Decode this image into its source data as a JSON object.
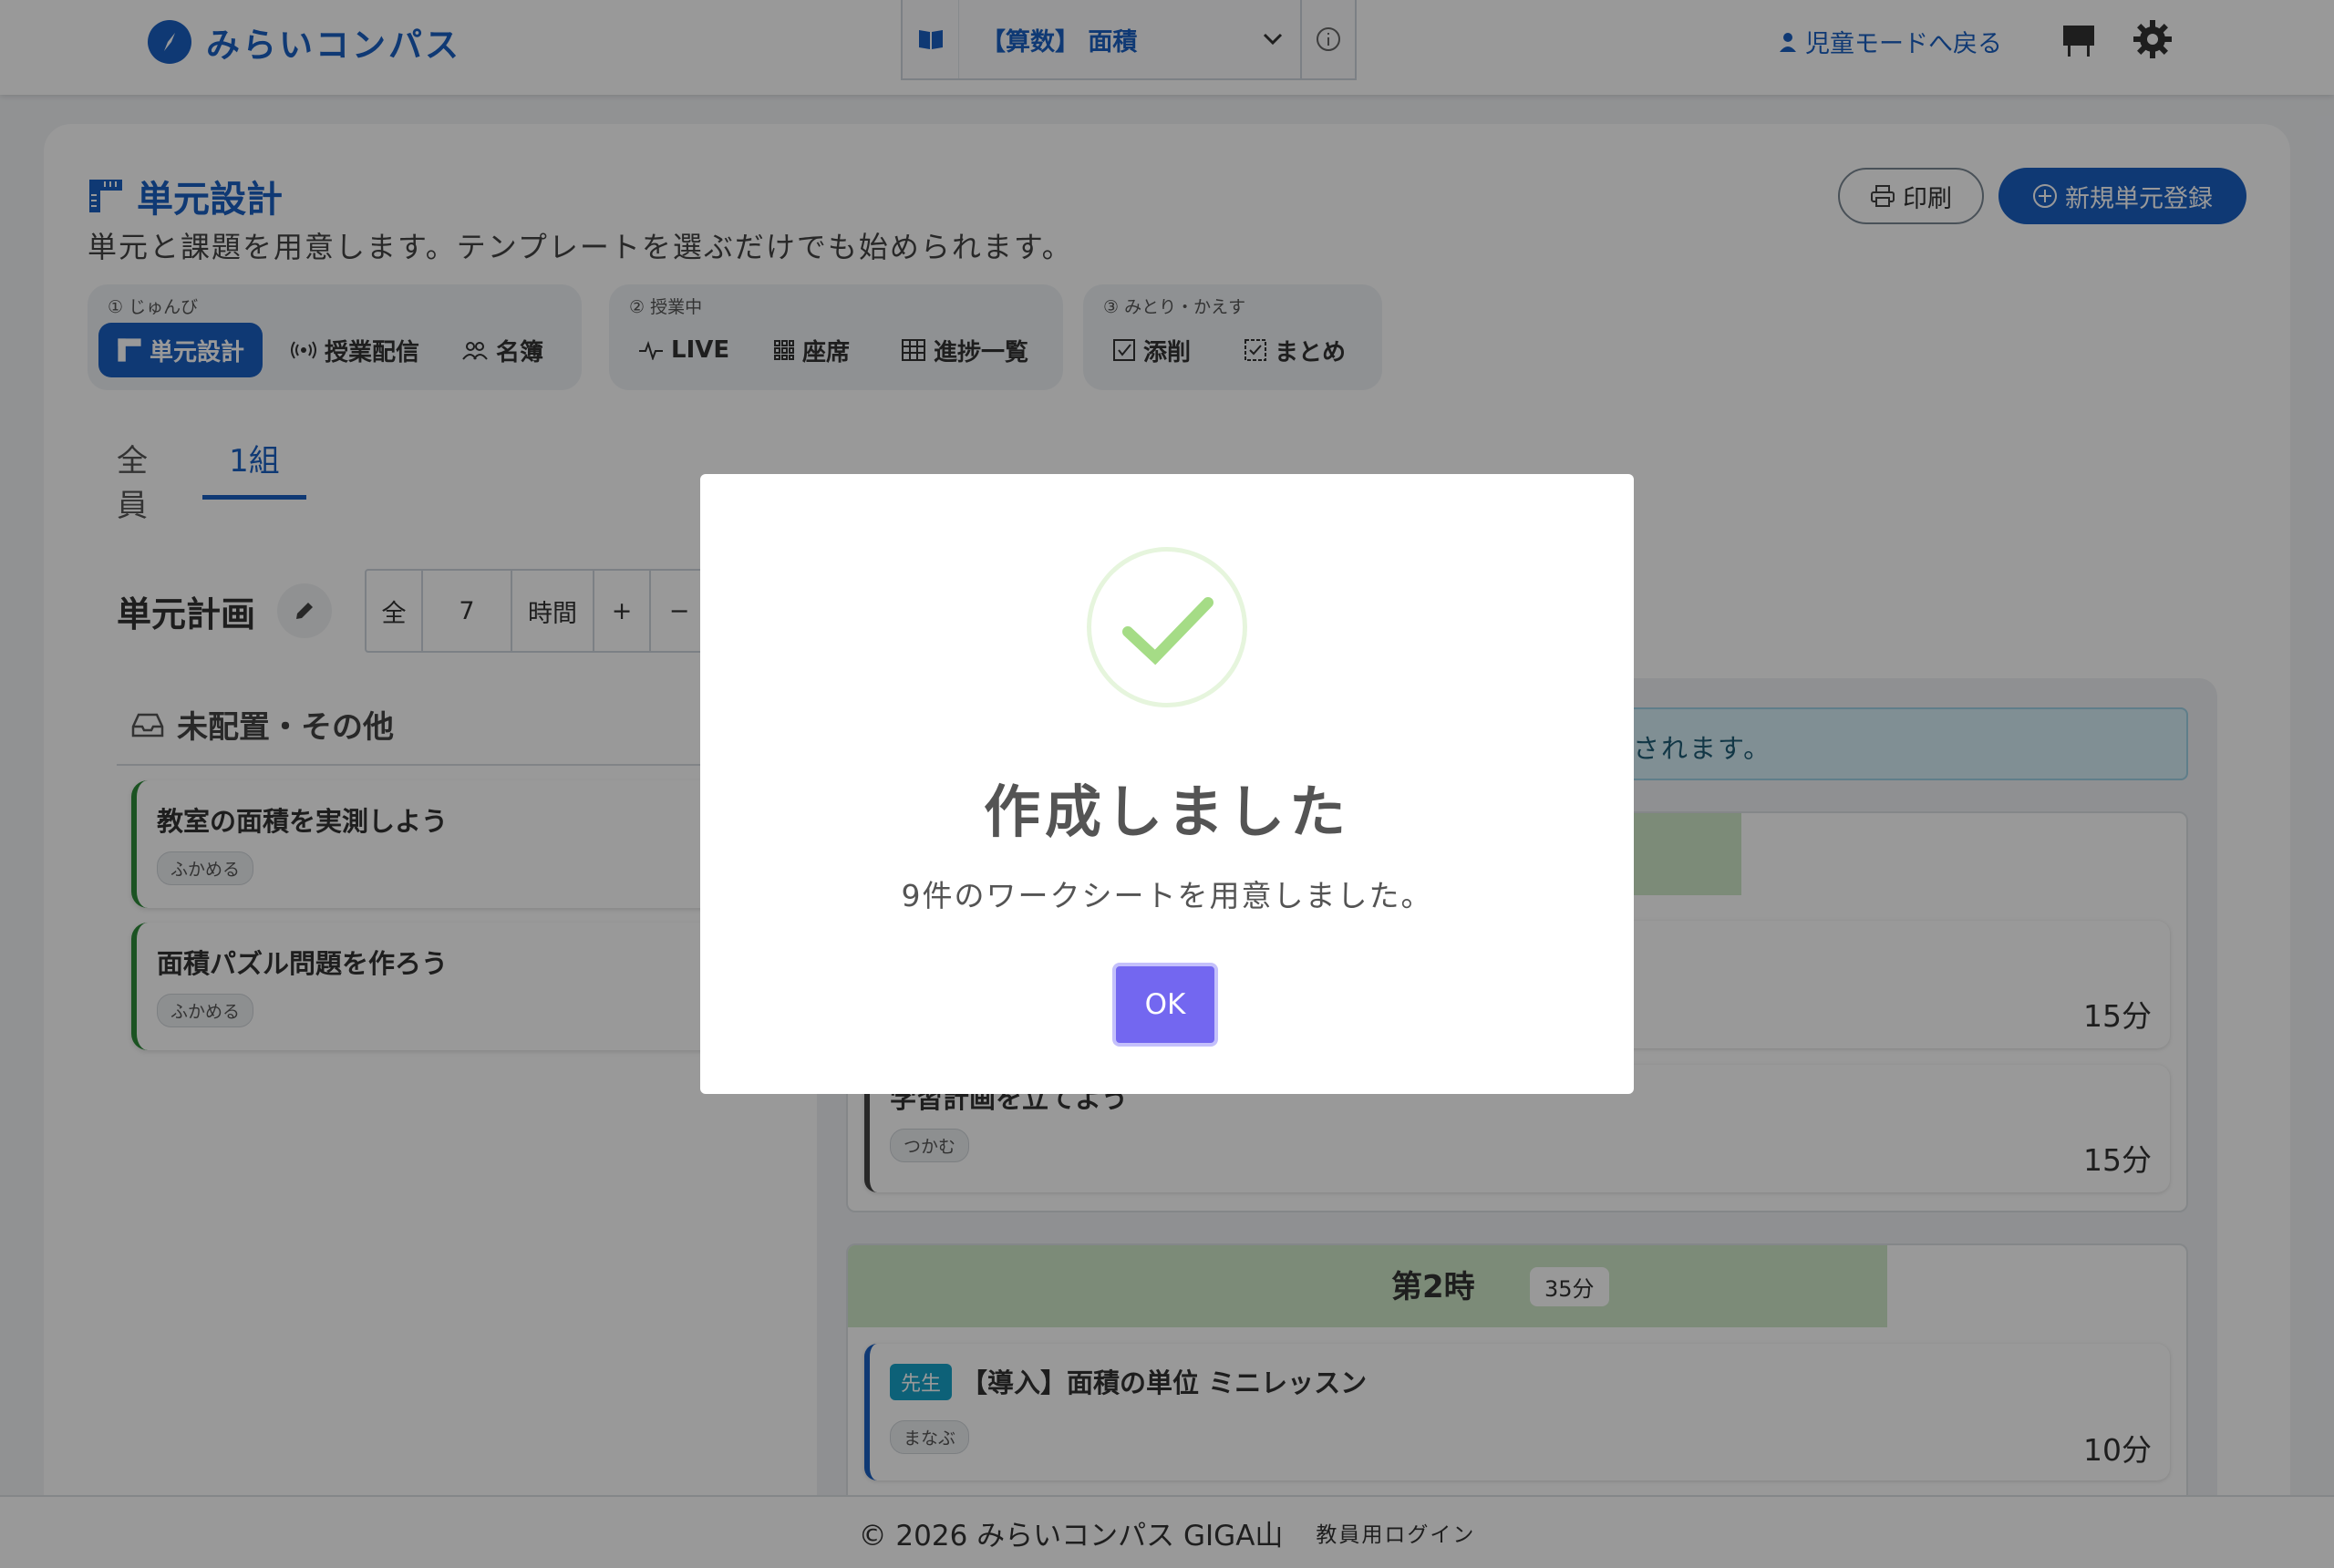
{
  "header": {
    "brand": "みらいコンパス",
    "unit_select": "【算数】 面積",
    "child_mode": "児童モードへ戻る"
  },
  "page": {
    "title": "単元設計",
    "subtitle": "単元と課題を用意します。テンプレートを選ぶだけでも始められます。",
    "print_button": "印刷",
    "new_unit_button": "新規単元登録"
  },
  "steps": [
    {
      "label": "① じゅんび",
      "items": [
        "単元設計",
        "授業配信",
        "名簿"
      ]
    },
    {
      "label": "② 授業中",
      "items": [
        "LIVE",
        "座席",
        "進捗一覧"
      ]
    },
    {
      "label": "③ みとり・かえす",
      "items": [
        "添削",
        "まとめ"
      ]
    }
  ],
  "tabs": [
    "全員",
    "1組"
  ],
  "plan": {
    "title": "単元計画",
    "prefix": "全",
    "hours": "7",
    "unit": "時間",
    "plus": "+",
    "minus": "−"
  },
  "unplaced": {
    "title": "未配置・その他",
    "tasks": [
      {
        "title": "教室の面積を実測しよう",
        "tag": "ふかめる"
      },
      {
        "title": "面積パズル問題を作ろう",
        "tag": "ふかめる"
      }
    ]
  },
  "info_banner": "存されます。",
  "period1": {
    "lessons": [
      {
        "duration": "15分"
      },
      {
        "title": "学習計画を立てよう",
        "tag": "つかむ",
        "duration": "15分"
      }
    ]
  },
  "period2": {
    "title": "第2時",
    "badge": "35分",
    "lesson": {
      "teacher": "先生",
      "title": "【導入】面積の単位 ミニレッスン",
      "tag": "まなぶ",
      "duration": "10分"
    }
  },
  "footer": {
    "copyright": "© 2026 みらいコンパス GIGA山",
    "login": "教員用ログイン"
  },
  "modal": {
    "title": "作成しました",
    "message": "9件のワークシートを用意しました。",
    "ok": "OK"
  },
  "colors": {
    "brand": "#1a5fc2",
    "period_header": "#cfe8c9",
    "ok_button": "#7367f0",
    "check": "#a5dc86"
  }
}
